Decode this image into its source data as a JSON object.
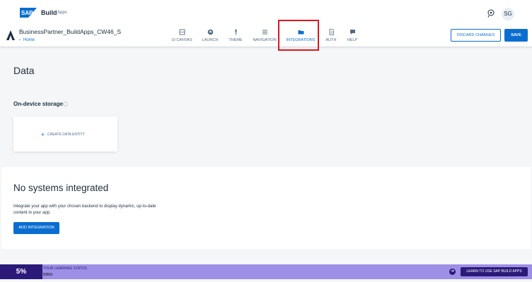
{
  "shell": {
    "logo_text": "SAP",
    "product": "Build",
    "product_sub": "Apps",
    "avatar_initials": "SG",
    "brand_color": "#0a6ed1"
  },
  "project": {
    "name": "BusinessPartner_BuildApps_CW46_S",
    "breadcrumb": "Home"
  },
  "nav": {
    "items": [
      {
        "label": "UI CANVAS",
        "icon": "ui-canvas-icon"
      },
      {
        "label": "LAUNCH",
        "icon": "launch-icon"
      },
      {
        "label": "THEME",
        "icon": "theme-brush-icon"
      },
      {
        "label": "NAVIGATION",
        "icon": "navigation-list-icon"
      },
      {
        "label": "INTEGRATIONS",
        "icon": "folder-icon",
        "active": true
      },
      {
        "label": "AUTH",
        "icon": "document-icon"
      },
      {
        "label": "HELP",
        "icon": "chat-icon"
      }
    ]
  },
  "actions": {
    "discard": "DISCARD CHANGES",
    "save": "SAVE"
  },
  "data_page": {
    "title": "Data",
    "storage_title": "On-device storage",
    "create_entity": "CREATE DATA ENTITY"
  },
  "integrations": {
    "title": "No systems integrated",
    "description": "Integrate your app with your chosen backend to display dynamic, up-to-date content in your app.",
    "add_button": "ADD INTEGRATION"
  },
  "learning": {
    "percent": "5%",
    "label": "YOUR LEARNING STATUS",
    "status": "Intro",
    "button": "LEARN TO USE SAP BUILD APPS",
    "accent": "#2c1a7a"
  }
}
